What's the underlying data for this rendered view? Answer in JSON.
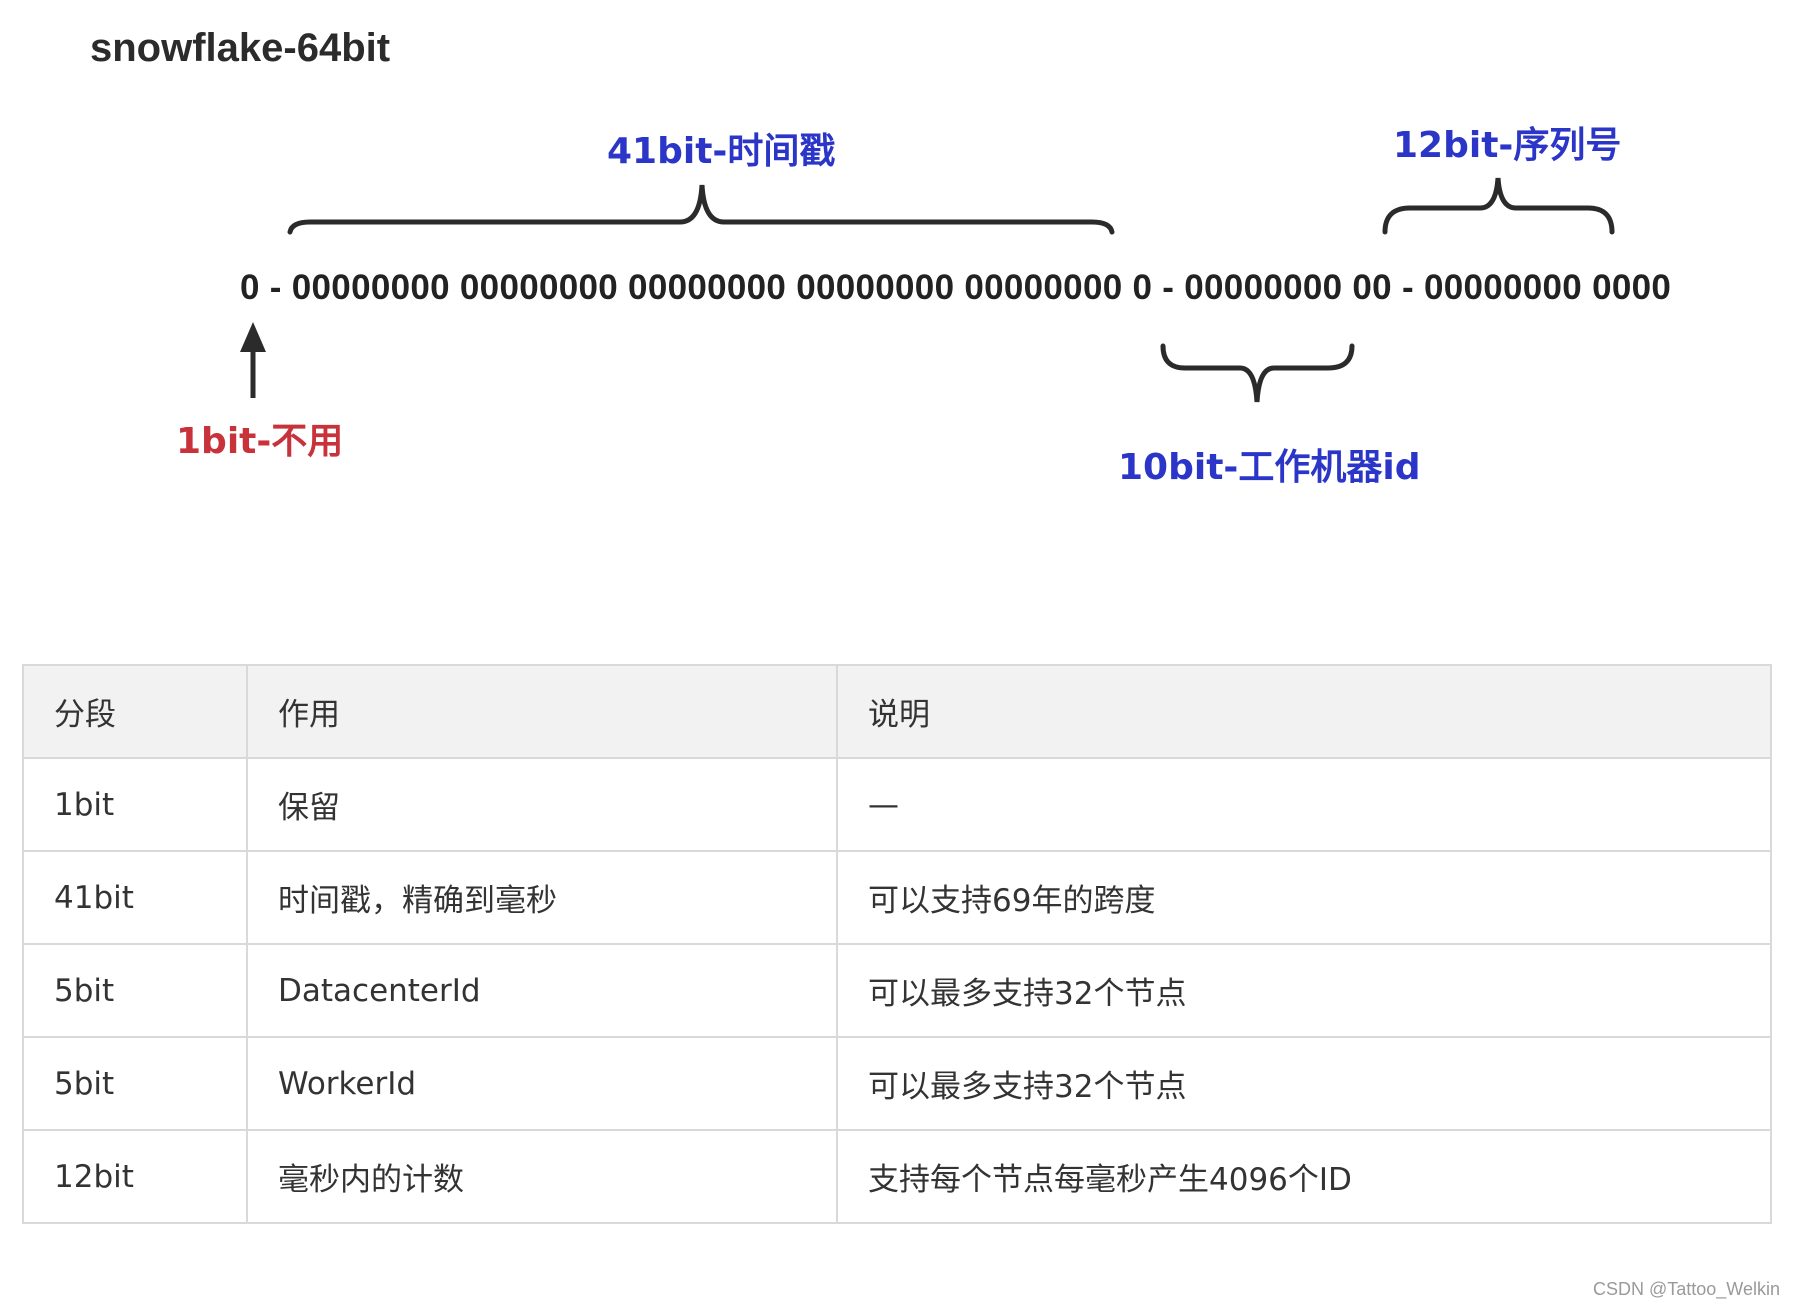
{
  "title": "snowflake-64bit",
  "bits": "0 - 00000000 00000000 00000000 00000000 00000000 0 - 00000000 00 - 00000000 0000",
  "segments": {
    "timestamp": {
      "label": "41bit-时间戳",
      "color": "#2b35c8"
    },
    "sequence": {
      "label": "12bit-序列号",
      "color": "#2b35c8"
    },
    "worker": {
      "label": "10bit-工作机器id",
      "color": "#2b35c8"
    },
    "unused": {
      "label": "1bit-不用",
      "color": "#c8323a"
    }
  },
  "table": {
    "headers": [
      "分段",
      "作用",
      "说明"
    ],
    "rows": [
      [
        "1bit",
        "保留",
        "—"
      ],
      [
        "41bit",
        "时间戳，精确到毫秒",
        "可以支持69年的跨度"
      ],
      [
        "5bit",
        "DatacenterId",
        "可以最多支持32个节点"
      ],
      [
        "5bit",
        "WorkerId",
        "可以最多支持32个节点"
      ],
      [
        "12bit",
        "毫秒内的计数",
        "支持每个节点每毫秒产生4096个ID"
      ]
    ]
  },
  "watermark": "CSDN @Tattoo_Welkin"
}
